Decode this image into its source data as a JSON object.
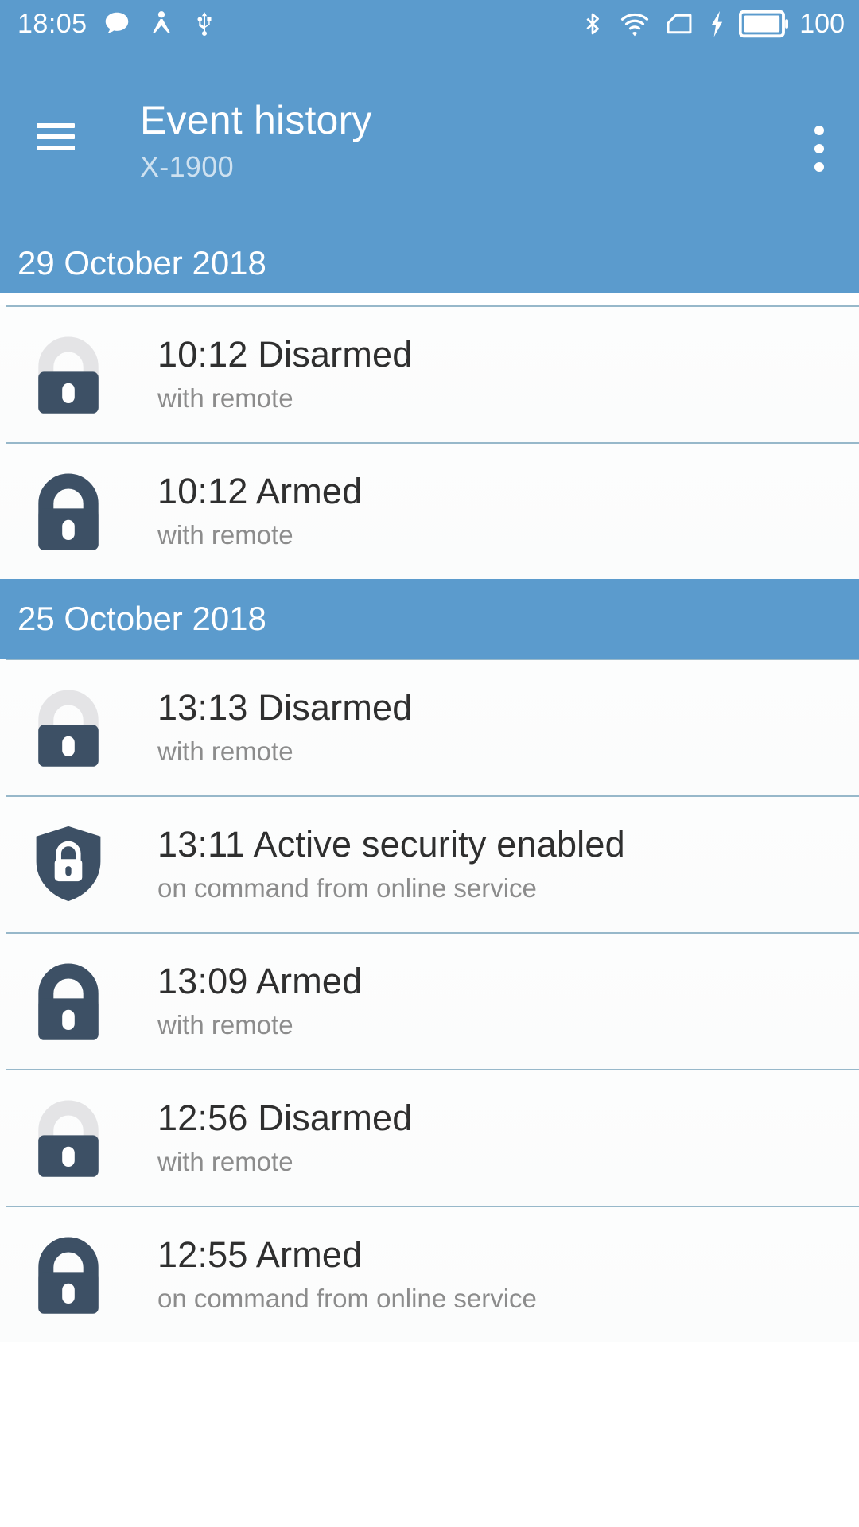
{
  "statusbar": {
    "time": "18:05",
    "battery_level": "100",
    "left_icons": [
      "message-bubble-icon",
      "screen-cast-icon",
      "usb-icon"
    ],
    "right_icons": [
      "bluetooth-icon",
      "wifi-icon",
      "sd-card-icon",
      "charging-bolt-icon",
      "battery-icon"
    ]
  },
  "appbar": {
    "menu_icon": "hamburger-menu-icon",
    "title": "Event history",
    "subtitle": "X-1900",
    "overflow_icon": "more-vertical-icon",
    "background_color": "#5b9bcd"
  },
  "colors": {
    "accent": "#5b9bcd",
    "icon_dark": "#3d5065",
    "icon_light": "#e4e4e6",
    "primary_text": "#2f2f2f",
    "secondary_text": "#8c8c8c",
    "divider": "#97b8ca"
  },
  "sections": [
    {
      "date": "29 October 2018",
      "events": [
        {
          "icon": "lock-open-icon",
          "time": "10:12",
          "event": "Disarmed",
          "title": "10:12 Disarmed",
          "detail": "with remote"
        },
        {
          "icon": "lock-closed-icon",
          "time": "10:12",
          "event": "Armed",
          "title": "10:12 Armed",
          "detail": "with remote"
        }
      ]
    },
    {
      "date": "25 October 2018",
      "events": [
        {
          "icon": "lock-open-icon",
          "time": "13:13",
          "event": "Disarmed",
          "title": "13:13 Disarmed",
          "detail": "with remote"
        },
        {
          "icon": "shield-lock-icon",
          "time": "13:11",
          "event": "Active security enabled",
          "title": "13:11 Active security enabled",
          "detail": "on command from online service"
        },
        {
          "icon": "lock-closed-icon",
          "time": "13:09",
          "event": "Armed",
          "title": "13:09 Armed",
          "detail": "with remote"
        },
        {
          "icon": "lock-open-icon",
          "time": "12:56",
          "event": "Disarmed",
          "title": "12:56 Disarmed",
          "detail": "with remote"
        },
        {
          "icon": "lock-closed-icon",
          "time": "12:55",
          "event": "Armed",
          "title": "12:55 Armed",
          "detail": "on command from online service"
        }
      ]
    }
  ]
}
